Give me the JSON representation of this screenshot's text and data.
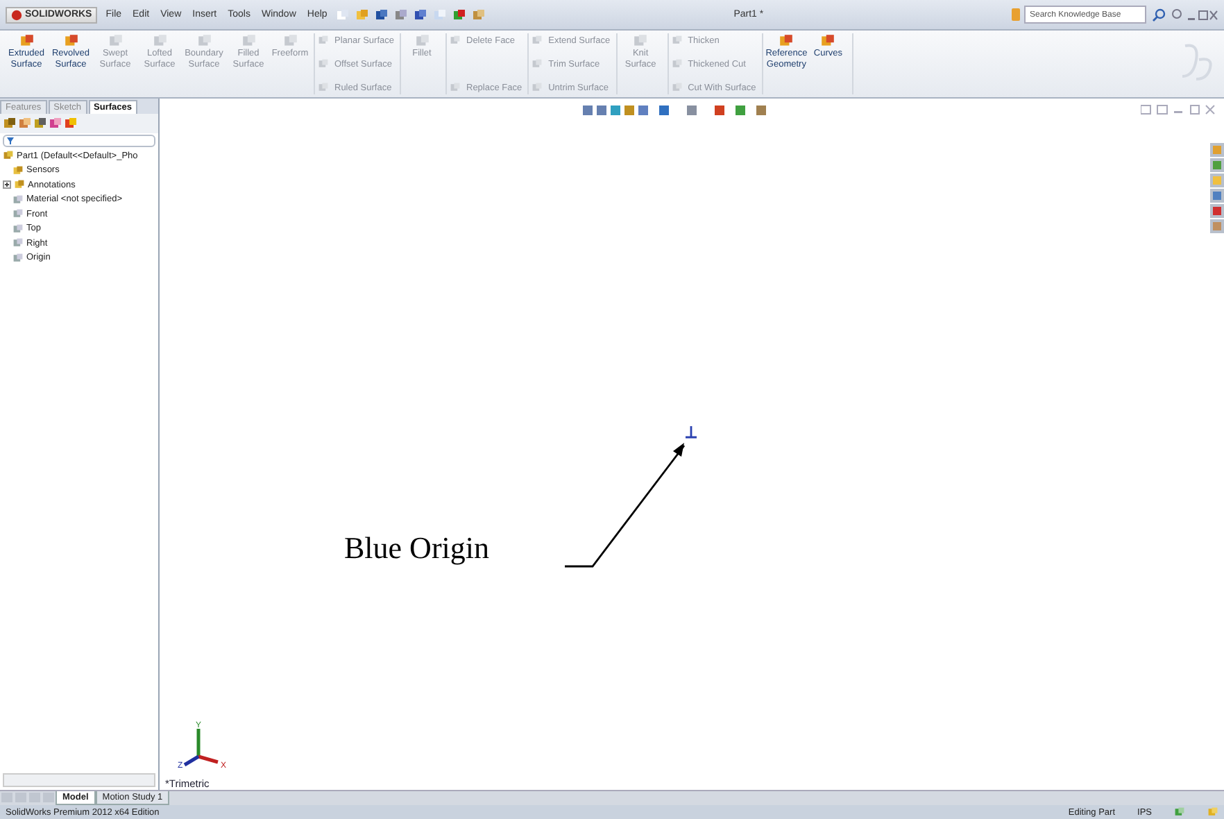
{
  "logo": "SOLIDWORKS",
  "menu": [
    "File",
    "Edit",
    "View",
    "Insert",
    "Tools",
    "Window",
    "Help"
  ],
  "title": "Part1 *",
  "search": {
    "placeholder": "Search Knowledge Base"
  },
  "ribbon": [
    {
      "kind": "large",
      "commands": [
        {
          "label": "Extruded Surface",
          "disabled": false
        },
        {
          "label": "Revolved Surface",
          "disabled": false
        },
        {
          "label": "Swept Surface",
          "disabled": true
        },
        {
          "label": "Lofted Surface",
          "disabled": true
        },
        {
          "label": "Boundary Surface",
          "disabled": true
        },
        {
          "label": "Filled Surface",
          "disabled": true
        },
        {
          "label": "Freeform",
          "disabled": true
        }
      ]
    },
    {
      "kind": "stack",
      "commands": [
        {
          "label": "Planar Surface",
          "disabled": true
        },
        {
          "label": "Offset Surface",
          "disabled": true
        },
        {
          "label": "Ruled Surface",
          "disabled": true
        }
      ]
    },
    {
      "kind": "large",
      "commands": [
        {
          "label": "Fillet",
          "disabled": true
        }
      ]
    },
    {
      "kind": "stack",
      "commands": [
        {
          "label": "Delete Face",
          "disabled": true
        },
        {
          "label": "Replace Face",
          "disabled": true
        }
      ]
    },
    {
      "kind": "stack",
      "commands": [
        {
          "label": "Extend Surface",
          "disabled": true
        },
        {
          "label": "Trim Surface",
          "disabled": true
        },
        {
          "label": "Untrim Surface",
          "disabled": true
        }
      ]
    },
    {
      "kind": "large",
      "commands": [
        {
          "label": "Knit Surface",
          "disabled": true
        }
      ]
    },
    {
      "kind": "stack",
      "commands": [
        {
          "label": "Thicken",
          "disabled": true
        },
        {
          "label": "Thickened Cut",
          "disabled": true
        },
        {
          "label": "Cut With Surface",
          "disabled": true
        }
      ]
    },
    {
      "kind": "large",
      "commands": [
        {
          "label": "Reference Geometry",
          "disabled": false
        },
        {
          "label": "Curves",
          "disabled": false
        }
      ]
    }
  ],
  "panel_tabs": [
    {
      "label": "Features",
      "selected": false
    },
    {
      "label": "Sketch",
      "selected": false
    },
    {
      "label": "Surfaces",
      "selected": true
    }
  ],
  "tree": {
    "label": "Part1  (Default<<Default>_Pho",
    "children": [
      {
        "label": "Sensors"
      },
      {
        "label": "Annotations",
        "expanded": false
      },
      {
        "label": "Material <not specified>"
      },
      {
        "label": "Front"
      },
      {
        "label": "Top"
      },
      {
        "label": "Right"
      },
      {
        "label": "Origin"
      }
    ]
  },
  "canvas": {
    "callout": "Blue Origin",
    "triad": [
      "Y",
      "Z",
      "X"
    ],
    "view_name": "*Trimetric"
  },
  "bottom_tabs": [
    {
      "label": "Model",
      "selected": true
    },
    {
      "label": "Motion Study 1",
      "selected": false
    }
  ],
  "status": {
    "edition": "SolidWorks Premium 2012 x64 Edition",
    "mode": "Editing Part",
    "units": "IPS"
  }
}
